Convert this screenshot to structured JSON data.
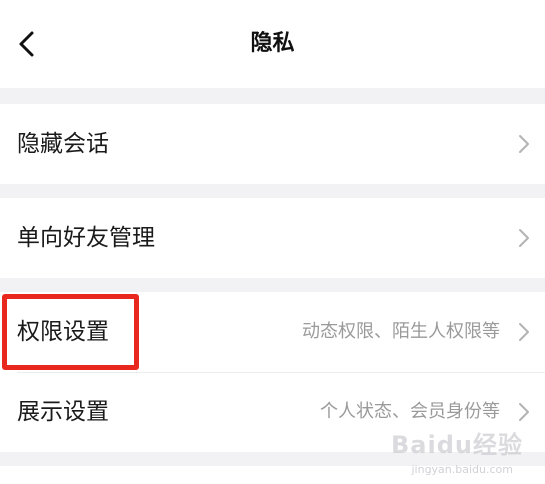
{
  "header": {
    "title": "隐私"
  },
  "rows": [
    {
      "label": "隐藏会话",
      "detail": ""
    },
    {
      "label": "单向好友管理",
      "detail": ""
    },
    {
      "label": "权限设置",
      "detail": "动态权限、陌生人权限等"
    },
    {
      "label": "展示设置",
      "detail": "个人状态、会员身份等"
    }
  ],
  "watermark": {
    "brand": "Baidu经验",
    "url": "jingyan.baidu.com"
  },
  "colors": {
    "highlight": "#e8271f",
    "background": "#f2f2f4"
  }
}
